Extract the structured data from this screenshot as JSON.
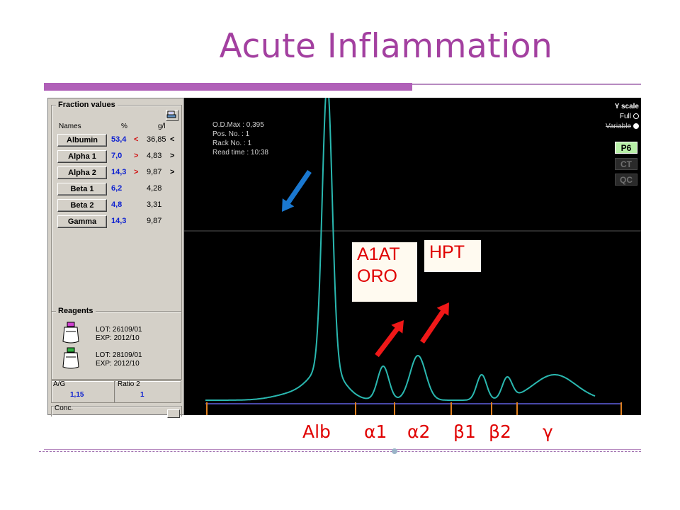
{
  "slide": {
    "title": "Acute Inflammation"
  },
  "fraction_values": {
    "legend": "Fraction values",
    "headers": {
      "names": "Names",
      "percent": "%",
      "gl": "g/l"
    },
    "rows": [
      {
        "name": "Albumin",
        "percent": "53,4",
        "percent_flag": "<",
        "gl": "36,85",
        "gl_flag": "<"
      },
      {
        "name": "Alpha 1",
        "percent": "7,0",
        "percent_flag": ">",
        "gl": "4,83",
        "gl_flag": ">"
      },
      {
        "name": "Alpha 2",
        "percent": "14,3",
        "percent_flag": ">",
        "gl": "9,87",
        "gl_flag": ">"
      },
      {
        "name": "Beta 1",
        "percent": "6,2",
        "percent_flag": "",
        "gl": "4,28",
        "gl_flag": ""
      },
      {
        "name": "Beta 2",
        "percent": "4,8",
        "percent_flag": "",
        "gl": "3,31",
        "gl_flag": ""
      },
      {
        "name": "Gamma",
        "percent": "14,3",
        "percent_flag": "",
        "gl": "9,87",
        "gl_flag": ""
      }
    ]
  },
  "reagents": {
    "legend": "Reagents",
    "items": [
      {
        "lot": "LOT:  26109/01",
        "exp": "EXP:  2012/10",
        "cap_color": "#d040d0"
      },
      {
        "lot": "LOT:  28109/01",
        "exp": "EXP:  2012/10",
        "cap_color": "#30b040"
      }
    ]
  },
  "ratios": {
    "ag_label": "A/G",
    "ag_value": "1,15",
    "ratio2_label": "Ratio 2",
    "ratio2_value": "1"
  },
  "conc": {
    "label": "Conc."
  },
  "graph_info": {
    "od_max": "O.D.Max : 0,395",
    "pos_no": "Pos. No.   : 1",
    "rack_no": "Rack No.  : 1",
    "read_time": "Read time : 10:38"
  },
  "y_scale": {
    "title": "Y scale",
    "full": "Full",
    "variable": "Variable",
    "tags": {
      "p6": "P6",
      "ct": "CT",
      "qc": "QC"
    }
  },
  "annotations": {
    "a1at": "A1AT",
    "oro": "ORO",
    "hpt": "HPT",
    "arrow_blue_color": "#1a78d0",
    "arrow_red_color": "#f01818"
  },
  "fraction_labels": {
    "alb": "Alb",
    "a1": "α1",
    "a2": "α2",
    "b1": "β1",
    "b2": "β2",
    "g": "γ"
  },
  "colors": {
    "title": "#a340a0",
    "curve": "#2ab8b0",
    "baseline": "#6060e0",
    "separator": "#e08020",
    "label_red": "#e00000"
  }
}
